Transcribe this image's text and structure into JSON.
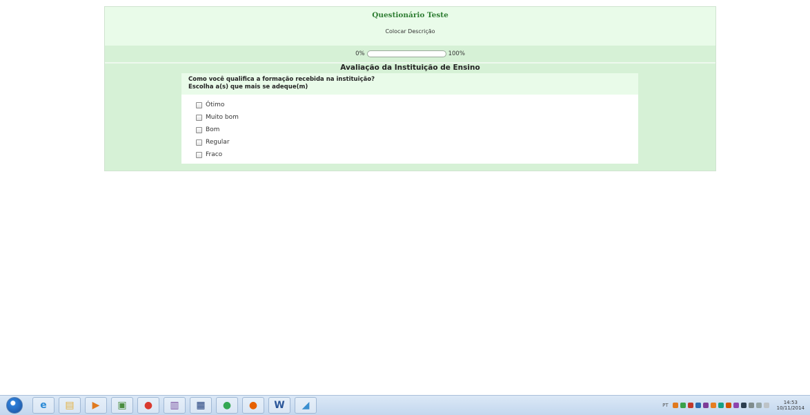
{
  "survey": {
    "title": "Questionário Teste",
    "description": "Colocar Descrição",
    "progress": {
      "min_label": "0%",
      "max_label": "100%",
      "value_percent": 0
    },
    "section_title": "Avaliação da Instituição de Ensino",
    "question": {
      "text": "Como você qualifica a formação recebida na instituição?",
      "instruction": "Escolha a(s) que mais se adeque(m)",
      "options": [
        "Ótimo",
        "Muito bom",
        "Bom",
        "Regular",
        "Fraco"
      ]
    }
  },
  "colors": {
    "title": "#2e7d32",
    "header_bg": "#e9fbe9",
    "panel_bg": "#d6f1d6",
    "taskbar": "#c3d7ee"
  },
  "taskbar": {
    "apps": [
      {
        "icon": "internet-explorer-icon",
        "glyph": "e",
        "color": "#2b8ad6"
      },
      {
        "icon": "file-explorer-icon",
        "glyph": "▤",
        "color": "#e3b040"
      },
      {
        "icon": "media-player-icon",
        "glyph": "▶",
        "color": "#e07a1f"
      },
      {
        "icon": "picture-app-icon",
        "glyph": "▣",
        "color": "#4a8d3f"
      },
      {
        "icon": "chrome-icon",
        "glyph": "●",
        "color": "#d93a2f"
      },
      {
        "icon": "winrar-icon",
        "glyph": "▥",
        "color": "#7a4f9e"
      },
      {
        "icon": "terminal-app-icon",
        "glyph": "▦",
        "color": "#1f3d7a"
      },
      {
        "icon": "chrome-icon",
        "glyph": "●",
        "color": "#34a853"
      },
      {
        "icon": "firefox-icon",
        "glyph": "●",
        "color": "#e66000"
      },
      {
        "icon": "word-icon",
        "glyph": "W",
        "color": "#2a5699"
      },
      {
        "icon": "paint-icon",
        "glyph": "◢",
        "color": "#3a8fd0"
      }
    ],
    "tray": {
      "language": "PT",
      "time": "14:53",
      "date": "10/11/2014"
    }
  }
}
